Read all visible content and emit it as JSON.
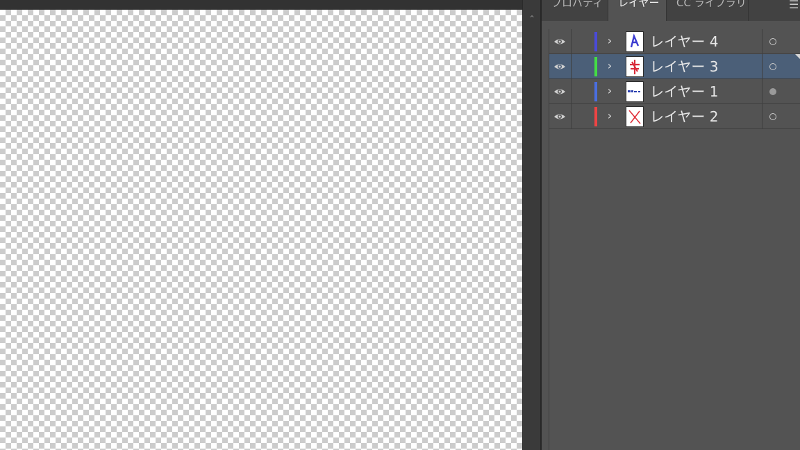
{
  "panel": {
    "tabs": [
      {
        "label": "プロパティ"
      },
      {
        "label": "レイヤー"
      },
      {
        "label": "CC ライブラリ"
      }
    ],
    "active_tab": "レイヤー",
    "menu_icon": "hamburger-menu-icon"
  },
  "layers": [
    {
      "name": "レイヤー 4",
      "color": "#4a4ad8",
      "selected": false,
      "visible": true,
      "target": "ring",
      "thumb": "letter-a-thumbnail"
    },
    {
      "name": "レイヤー 3",
      "color": "#44dd44",
      "selected": true,
      "visible": true,
      "target": "ring",
      "thumb": "red-mark-thumbnail"
    },
    {
      "name": "レイヤー 1",
      "color": "#4a6ee0",
      "selected": false,
      "visible": true,
      "target": "filled",
      "thumb": "blue-text-thumbnail"
    },
    {
      "name": "レイヤー 2",
      "color": "#ee4444",
      "selected": false,
      "visible": true,
      "target": "ring",
      "thumb": "red-x-thumbnail"
    }
  ],
  "colors": {
    "selected_row": "#4b5f78",
    "panel_bg": "#535353"
  }
}
